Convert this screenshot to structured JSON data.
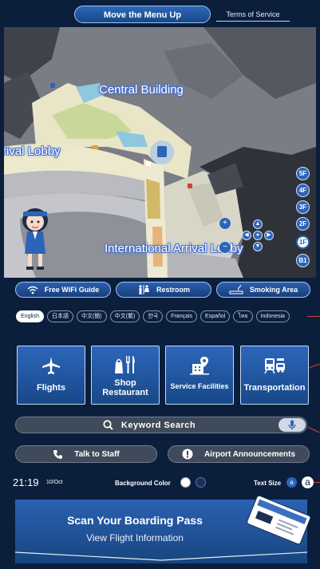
{
  "top": {
    "move_menu_label": "Move the Menu Up",
    "terms_label": "Terms of Service"
  },
  "map": {
    "labels": {
      "central": "Central Building",
      "arrival_left": "rival Lobby",
      "international": "International Arrival Lobby"
    },
    "floors": [
      "5F",
      "4F",
      "3F",
      "2F",
      "1F",
      "B1"
    ],
    "selected_floor": "1F"
  },
  "facilities": {
    "wifi": "Free WiFi Guide",
    "restroom": "Restroom",
    "smoking": "Smoking Area"
  },
  "languages": [
    "English",
    "日本語",
    "中文(簡)",
    "中文(繁)",
    "한국",
    "Français",
    "Español",
    "ไทย",
    "Indonesia"
  ],
  "selected_language": "English",
  "categories": {
    "flights": "Flights",
    "shop_line1": "Shop",
    "shop_line2": "Restaurant",
    "services": "Service Facilities",
    "transport": "Transportation"
  },
  "search": {
    "label": "Keyword Search"
  },
  "actions": {
    "talk": "Talk to Staff",
    "announcements": "Airport Announcements"
  },
  "status": {
    "time": "21:19",
    "date": "10/Oct",
    "bg_label": "Background Color",
    "text_size_label": "Text Size",
    "text_small": "a",
    "text_large": "a"
  },
  "boarding": {
    "title": "Scan Your Boarding Pass",
    "subtitle": "View Flight Information"
  },
  "colors": {
    "accent_blue": "#2c64b8",
    "background": "#0b1f3d",
    "pill_grey": "#3f4a5a"
  }
}
